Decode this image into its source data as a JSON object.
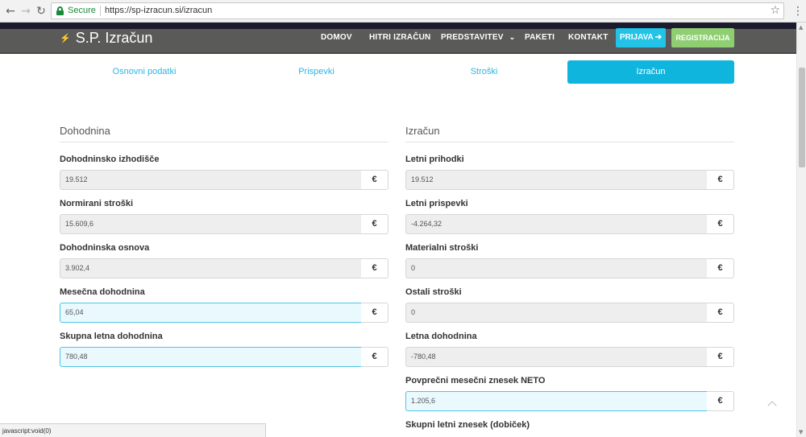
{
  "browser": {
    "secure_label": "Secure",
    "url": "https://sp-izracun.si/izracun",
    "back_icon": "arrow-left-icon",
    "forward_icon": "arrow-right-icon",
    "reload_icon": "reload-icon",
    "star_icon": "star-icon",
    "menu_icon": "kebab-menu-icon"
  },
  "site": {
    "logo_text": "S.P. Izračun",
    "nav": {
      "domov": "DOMOV",
      "hitri": "HITRI IZRAČUN",
      "predstavitev": "PREDSTAVITEV",
      "paketi": "PAKETI",
      "kontakt": "KONTAKT",
      "prijava": "PRIJAVA",
      "registracija": "REGISTRACIJA"
    }
  },
  "tabs": {
    "osnovni": "Osnovni podatki",
    "prispevki": "Prispevki",
    "stroski": "Stroški",
    "izracun": "Izračun",
    "active": "Izračun"
  },
  "dohodnina": {
    "title": "Dohodnina",
    "fields": [
      {
        "label": "Dohodninsko izhodišče",
        "value": "19.512",
        "unit": "€"
      },
      {
        "label": "Normirani stroški",
        "value": "15.609,6",
        "unit": "€"
      },
      {
        "label": "Dohodninska osnova",
        "value": "3.902,4",
        "unit": "€"
      },
      {
        "label": "Mesečna dohodnina",
        "value": "65,04",
        "unit": "€"
      },
      {
        "label": "Skupna letna dohodnina",
        "value": "780,48",
        "unit": "€"
      }
    ]
  },
  "izracun": {
    "title": "Izračun",
    "fields": [
      {
        "label": "Letni prihodki",
        "value": "19.512",
        "unit": "€"
      },
      {
        "label": "Letni prispevki",
        "value": "-4.264,32",
        "unit": "€"
      },
      {
        "label": "Materialni stroški",
        "value": "0",
        "unit": "€"
      },
      {
        "label": "Ostali stroški",
        "value": "0",
        "unit": "€"
      },
      {
        "label": "Letna dohodnina",
        "value": "-780,48",
        "unit": "€"
      },
      {
        "label": "Povprečni mesečni znesek NETO",
        "value": "1.205,6",
        "unit": "€"
      },
      {
        "label": "Skupni letni znesek (dobiček)"
      }
    ]
  },
  "status_bar": "javascript:void(0)",
  "colors": {
    "accent": "#10b5de",
    "header_bg": "#5a5a58",
    "login_bg": "#22c3e6",
    "register_bg": "#8fcf72",
    "editable_bg": "#e9f9fe"
  }
}
